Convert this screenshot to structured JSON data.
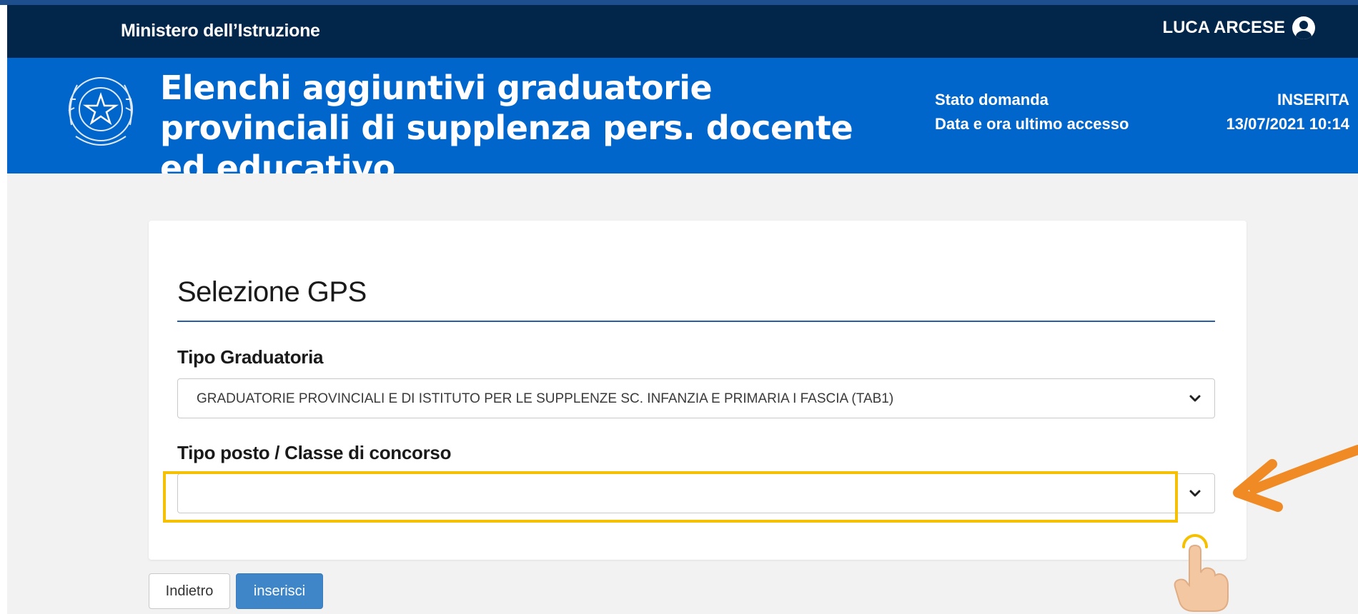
{
  "topbar": {
    "ministry": "Ministero dell’Istruzione",
    "user_name": "LUCA ARCESE"
  },
  "header": {
    "title": "Elenchi aggiuntivi graduatorie provinciali di supplenza pers. docente ed educativo",
    "status_label": "Stato domanda",
    "status_value": "INSERITA",
    "last_access_label": "Data e ora ultimo accesso",
    "last_access_value": "13/07/2021 10:14"
  },
  "form": {
    "title": "Selezione GPS",
    "tipo_graduatoria": {
      "label": "Tipo Graduatoria",
      "value": "GRADUATORIE PROVINCIALI E DI ISTITUTO PER LE SUPPLENZE SC. INFANZIA E PRIMARIA I FASCIA (TAB1)"
    },
    "tipo_posto": {
      "label": "Tipo posto / Classe di concorso",
      "value": ""
    }
  },
  "actions": {
    "back_label": "Indietro",
    "insert_label": "inserisci"
  },
  "colors": {
    "topbar": "#02254a",
    "header": "#0066cc",
    "highlight": "#f5c000",
    "annotation_arrow": "#f08a24",
    "primary_button": "#3f86c8"
  },
  "icons": [
    "user-circle-icon",
    "italian-emblem-icon",
    "chevron-down-icon",
    "annotation-arrow-icon",
    "pointing-hand-icon"
  ]
}
